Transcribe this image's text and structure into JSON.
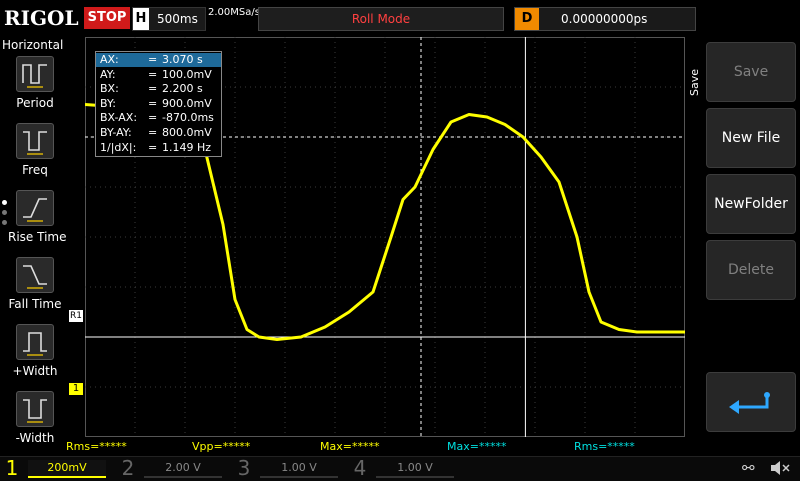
{
  "header": {
    "brand": "RIGOL",
    "run_state": "STOP",
    "horizontal_label": "H",
    "timebase": "500ms",
    "sample_rate": "2.00MSa/s",
    "mode": "Roll Mode",
    "delay_label": "D",
    "delay_value": "0.00000000ps"
  },
  "left_menu": {
    "title": "Horizontal",
    "items": [
      {
        "label": "Period",
        "icon": "period-icon"
      },
      {
        "label": "Freq",
        "icon": "freq-icon"
      },
      {
        "label": "Rise Time",
        "icon": "rise-time-icon"
      },
      {
        "label": "Fall Time",
        "icon": "fall-time-icon"
      },
      {
        "label": "+Width",
        "icon": "positive-width-icon"
      },
      {
        "label": "-Width",
        "icon": "negative-width-icon"
      }
    ]
  },
  "cursor": {
    "rows": [
      {
        "key": "AX:",
        "eq": "=",
        "value": "3.070 s"
      },
      {
        "key": "AY:",
        "eq": "=",
        "value": "100.0mV"
      },
      {
        "key": "BX:",
        "eq": "=",
        "value": "2.200 s"
      },
      {
        "key": "BY:",
        "eq": "=",
        "value": "900.0mV"
      },
      {
        "key": "BX-AX:",
        "eq": "=",
        "value": "-870.0ms"
      },
      {
        "key": "BY-AY:",
        "eq": "=",
        "value": "800.0mV"
      },
      {
        "key": "1/|dX|:",
        "eq": "=",
        "value": "1.149 Hz"
      }
    ]
  },
  "markers": {
    "ch1_ref": "1",
    "ref_r1": "R1"
  },
  "measurements": [
    "Rms=*****",
    "Vpp=*****",
    "Max=*****",
    "Max=*****",
    "Rms=*****"
  ],
  "right_menu": {
    "section": "Save",
    "buttons": [
      {
        "label": "Save",
        "enabled": false
      },
      {
        "label": "New File",
        "enabled": true
      },
      {
        "label": "NewFolder",
        "enabled": true
      },
      {
        "label": "Delete",
        "enabled": false
      }
    ],
    "back_icon": "return-arrow-icon"
  },
  "channels": [
    {
      "num": "1",
      "scale": "200mV",
      "color": "#ffff00"
    },
    {
      "num": "2",
      "scale": "2.00 V",
      "color": "#00e0e0"
    },
    {
      "num": "3",
      "scale": "1.00 V",
      "color": "#e040e0"
    },
    {
      "num": "4",
      "scale": "1.00 V",
      "color": "#3060ff"
    }
  ],
  "status_icons": [
    "usb-icon",
    "speaker-muted-icon"
  ],
  "colors": {
    "trace": "#ffff00",
    "stop": "#d01a1a",
    "roll_mode_text": "#ff4040",
    "delay_badge": "#f08a00",
    "cursor_highlight": "#1e6a9a"
  },
  "chart_data": {
    "type": "line",
    "title": "",
    "xlabel": "",
    "ylabel": "",
    "x_unit": "s",
    "y_unit": "V",
    "xlim": [
      -0.6,
      4.4
    ],
    "ylim": [
      -0.3,
      1.3
    ],
    "series": [
      {
        "x": [
          -0.6,
          -0.3,
          0.0,
          0.2,
          0.4,
          0.55,
          0.65,
          0.75,
          0.85,
          1.0,
          1.2,
          1.4,
          1.6,
          1.8,
          1.95,
          2.05,
          2.15,
          2.3,
          2.45,
          2.6,
          2.75,
          2.9,
          3.05,
          3.2,
          3.35,
          3.5,
          3.6,
          3.7,
          3.85,
          4.0,
          4.2,
          4.4
        ],
        "y": [
          1.03,
          1.02,
          0.98,
          0.97,
          0.85,
          0.55,
          0.25,
          0.13,
          0.1,
          0.09,
          0.1,
          0.14,
          0.2,
          0.28,
          0.5,
          0.65,
          0.7,
          0.85,
          0.96,
          0.99,
          0.98,
          0.95,
          0.9,
          0.82,
          0.72,
          0.5,
          0.28,
          0.16,
          0.13,
          0.12,
          0.12,
          0.12
        ]
      }
    ],
    "cursors": {
      "AX": 3.07,
      "AY": 0.1,
      "BX": 2.2,
      "BY": 0.9
    },
    "grid": true
  }
}
